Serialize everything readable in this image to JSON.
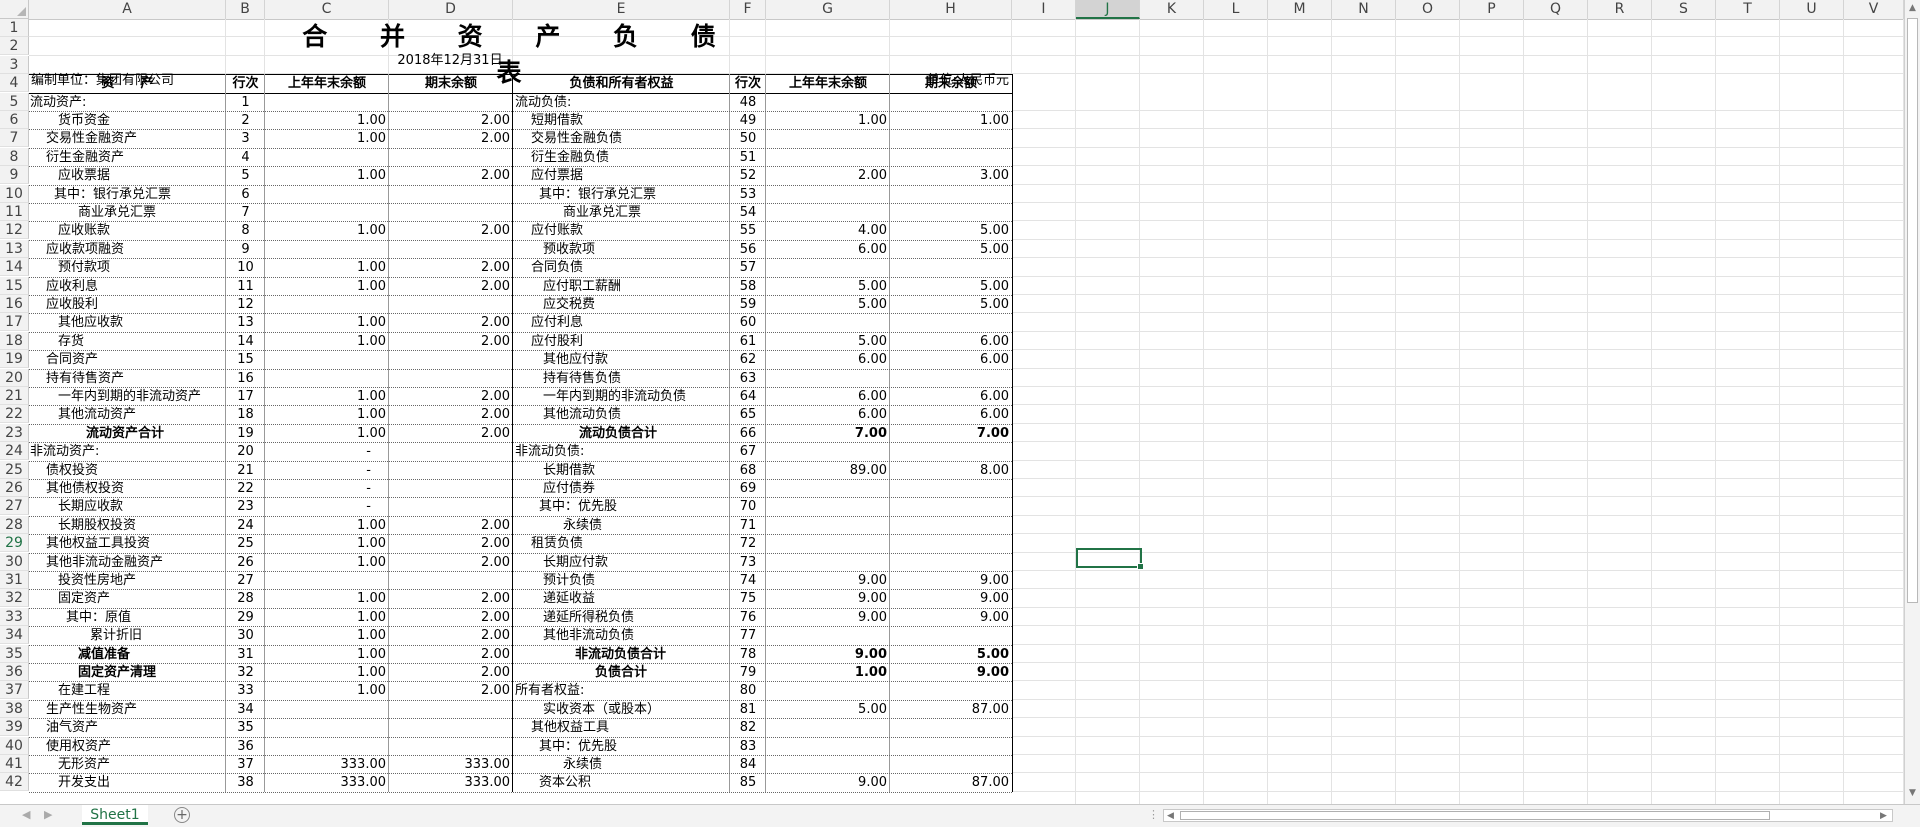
{
  "sheet": {
    "columns": [
      "A",
      "B",
      "C",
      "D",
      "E",
      "F",
      "G",
      "H",
      "I",
      "J",
      "K",
      "L",
      "M",
      "N",
      "O",
      "P",
      "Q",
      "R",
      "S",
      "T",
      "U",
      "V"
    ],
    "selected_column": "J",
    "selected_row": "29",
    "tab_name": "Sheet1",
    "add_sheet_symbol": "+",
    "colors": {
      "accent": "#217346",
      "grid": "#e3e3e3",
      "header_bg": "#f2f2f2"
    }
  },
  "report": {
    "title": "合 并 资 产 负 债 表",
    "date": "2018年12月31日",
    "unit_left": "编制单位：集团有限公司",
    "unit_right": "单位:人民币元",
    "headers": [
      "资　　产",
      "行次",
      "上年年末余额",
      "期末余额",
      "负债和所有者权益",
      "行次",
      "上年年末余额",
      "期末余额"
    ],
    "rows": [
      {
        "r": "5",
        "a": "流动资产:",
        "b": "1",
        "c": "",
        "d": "",
        "e": "流动负债:",
        "f": "48",
        "g": "",
        "h": ""
      },
      {
        "r": "6",
        "a": "货币资金",
        "b": "2",
        "c": "1.00",
        "d": "2.00",
        "e": "短期借款",
        "f": "49",
        "g": "1.00",
        "h": "1.00"
      },
      {
        "r": "7",
        "a": "交易性金融资产",
        "b": "3",
        "c": "1.00",
        "d": "2.00",
        "e": "交易性金融负债",
        "f": "50",
        "g": "",
        "h": ""
      },
      {
        "r": "8",
        "a": "衍生金融资产",
        "b": "4",
        "c": "",
        "d": "",
        "e": "衍生金融负债",
        "f": "51",
        "g": "",
        "h": ""
      },
      {
        "r": "9",
        "a": "应收票据",
        "b": "5",
        "c": "1.00",
        "d": "2.00",
        "e": "应付票据",
        "f": "52",
        "g": "2.00",
        "h": "3.00"
      },
      {
        "r": "10",
        "a": "其中：银行承兑汇票",
        "b": "6",
        "c": "",
        "d": "",
        "e": "其中：银行承兑汇票",
        "f": "53",
        "g": "",
        "h": ""
      },
      {
        "r": "11",
        "a": "商业承兑汇票",
        "b": "7",
        "c": "",
        "d": "",
        "e": "商业承兑汇票",
        "f": "54",
        "g": "",
        "h": ""
      },
      {
        "r": "12",
        "a": "应收账款",
        "b": "8",
        "c": "1.00",
        "d": "2.00",
        "e": "应付账款",
        "f": "55",
        "g": "4.00",
        "h": "5.00"
      },
      {
        "r": "13",
        "a": "应收款项融资",
        "b": "9",
        "c": "",
        "d": "",
        "e": "预收款项",
        "f": "56",
        "g": "6.00",
        "h": "5.00"
      },
      {
        "r": "14",
        "a": "预付款项",
        "b": "10",
        "c": "1.00",
        "d": "2.00",
        "e": "合同负债",
        "f": "57",
        "g": "",
        "h": ""
      },
      {
        "r": "15",
        "a": "应收利息",
        "b": "11",
        "c": "1.00",
        "d": "2.00",
        "e": "应付职工薪酬",
        "f": "58",
        "g": "5.00",
        "h": "5.00"
      },
      {
        "r": "16",
        "a": "应收股利",
        "b": "12",
        "c": "",
        "d": "",
        "e": "应交税费",
        "f": "59",
        "g": "5.00",
        "h": "5.00"
      },
      {
        "r": "17",
        "a": "其他应收款",
        "b": "13",
        "c": "1.00",
        "d": "2.00",
        "e": "应付利息",
        "f": "60",
        "g": "",
        "h": ""
      },
      {
        "r": "18",
        "a": "存货",
        "b": "14",
        "c": "1.00",
        "d": "2.00",
        "e": "应付股利",
        "f": "61",
        "g": "5.00",
        "h": "6.00"
      },
      {
        "r": "19",
        "a": "合同资产",
        "b": "15",
        "c": "",
        "d": "",
        "e": "其他应付款",
        "f": "62",
        "g": "6.00",
        "h": "6.00"
      },
      {
        "r": "20",
        "a": "持有待售资产",
        "b": "16",
        "c": "",
        "d": "",
        "e": "持有待售负债",
        "f": "63",
        "g": "",
        "h": ""
      },
      {
        "r": "21",
        "a": "一年内到期的非流动资产",
        "b": "17",
        "c": "1.00",
        "d": "2.00",
        "e": "一年内到期的非流动负债",
        "f": "64",
        "g": "6.00",
        "h": "6.00"
      },
      {
        "r": "22",
        "a": "其他流动资产",
        "b": "18",
        "c": "1.00",
        "d": "2.00",
        "e": "其他流动负债",
        "f": "65",
        "g": "6.00",
        "h": "6.00"
      },
      {
        "r": "23",
        "a": "流动资产合计",
        "b": "19",
        "c": "1.00",
        "d": "2.00",
        "e": "流动负债合计",
        "f": "66",
        "g": "7.00",
        "h": "7.00"
      },
      {
        "r": "24",
        "a": "非流动资产:",
        "b": "20",
        "c": "-",
        "d": "",
        "e": "非流动负债:",
        "f": "67",
        "g": "",
        "h": ""
      },
      {
        "r": "25",
        "a": "债权投资",
        "b": "21",
        "c": "-",
        "d": "",
        "e": "长期借款",
        "f": "68",
        "g": "89.00",
        "h": "8.00"
      },
      {
        "r": "26",
        "a": "其他债权投资",
        "b": "22",
        "c": "-",
        "d": "",
        "e": "应付债券",
        "f": "69",
        "g": "",
        "h": ""
      },
      {
        "r": "27",
        "a": "长期应收款",
        "b": "23",
        "c": "-",
        "d": "",
        "e": "其中：优先股",
        "f": "70",
        "g": "",
        "h": ""
      },
      {
        "r": "28",
        "a": "长期股权投资",
        "b": "24",
        "c": "1.00",
        "d": "2.00",
        "e": "永续债",
        "f": "71",
        "g": "",
        "h": ""
      },
      {
        "r": "29",
        "a": "其他权益工具投资",
        "b": "25",
        "c": "1.00",
        "d": "2.00",
        "e": "租赁负债",
        "f": "72",
        "g": "",
        "h": ""
      },
      {
        "r": "30",
        "a": "其他非流动金融资产",
        "b": "26",
        "c": "1.00",
        "d": "2.00",
        "e": "长期应付款",
        "f": "73",
        "g": "",
        "h": ""
      },
      {
        "r": "31",
        "a": "投资性房地产",
        "b": "27",
        "c": "",
        "d": "",
        "e": "预计负债",
        "f": "74",
        "g": "9.00",
        "h": "9.00"
      },
      {
        "r": "32",
        "a": "固定资产",
        "b": "28",
        "c": "1.00",
        "d": "2.00",
        "e": "递延收益",
        "f": "75",
        "g": "9.00",
        "h": "9.00"
      },
      {
        "r": "33",
        "a": "其中：原值",
        "b": "29",
        "c": "1.00",
        "d": "2.00",
        "e": "递延所得税负债",
        "f": "76",
        "g": "9.00",
        "h": "9.00"
      },
      {
        "r": "34",
        "a": "累计折旧",
        "b": "30",
        "c": "1.00",
        "d": "2.00",
        "e": "其他非流动负债",
        "f": "77",
        "g": "",
        "h": ""
      },
      {
        "r": "35",
        "a": "减值准备",
        "b": "31",
        "c": "1.00",
        "d": "2.00",
        "e": "非流动负债合计",
        "f": "78",
        "g": "9.00",
        "h": "5.00"
      },
      {
        "r": "36",
        "a": "固定资产清理",
        "b": "32",
        "c": "1.00",
        "d": "2.00",
        "e": "负债合计",
        "f": "79",
        "g": "1.00",
        "h": "9.00"
      },
      {
        "r": "37",
        "a": "在建工程",
        "b": "33",
        "c": "1.00",
        "d": "2.00",
        "e": "所有者权益:",
        "f": "80",
        "g": "",
        "h": ""
      },
      {
        "r": "38",
        "a": "生产性生物资产",
        "b": "34",
        "c": "",
        "d": "",
        "e": "实收资本（或股本）",
        "f": "81",
        "g": "5.00",
        "h": "87.00"
      },
      {
        "r": "39",
        "a": "油气资产",
        "b": "35",
        "c": "",
        "d": "",
        "e": "其他权益工具",
        "f": "82",
        "g": "",
        "h": ""
      },
      {
        "r": "40",
        "a": "使用权资产",
        "b": "36",
        "c": "",
        "d": "",
        "e": "其中：优先股",
        "f": "83",
        "g": "",
        "h": ""
      },
      {
        "r": "41",
        "a": "无形资产",
        "b": "37",
        "c": "333.00",
        "d": "333.00",
        "e": "永续债",
        "f": "84",
        "g": "",
        "h": ""
      },
      {
        "r": "42",
        "a": "开发支出",
        "b": "38",
        "c": "333.00",
        "d": "333.00",
        "e": "资本公积",
        "f": "85",
        "g": "9.00",
        "h": "87.00"
      }
    ]
  }
}
